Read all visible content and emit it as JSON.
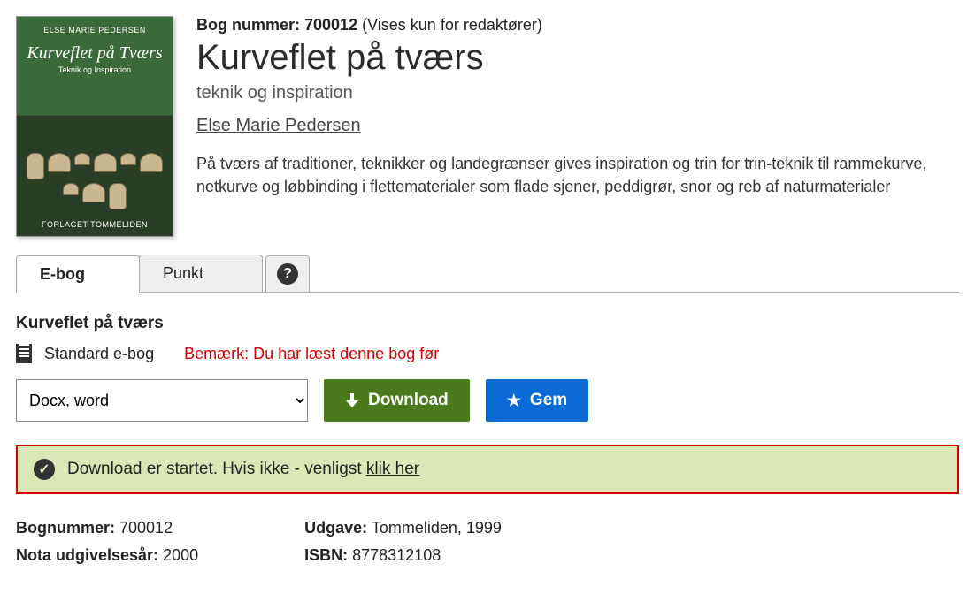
{
  "header": {
    "bognum_label": "Bog nummer:",
    "bognum_value": "700012",
    "bognum_note": "(Vises kun for redaktører)",
    "title": "Kurveflet på tværs",
    "subtitle": "teknik og inspiration",
    "author": "Else Marie Pedersen",
    "description": "På tværs af traditioner, teknikker og landegrænser gives inspiration og trin for trin-teknik til rammekurve, netkurve og løbbinding i flettematerialer som flade sjener, peddigrør, snor og reb af naturmaterialer"
  },
  "cover": {
    "author": "ELSE MARIE PEDERSEN",
    "title": "Kurveflet på Tværs",
    "sub": "Teknik og Inspiration",
    "publisher": "FORLAGET TOMMELIDEN"
  },
  "tabs": {
    "ebog": "E-bog",
    "punkt": "Punkt",
    "help_char": "?"
  },
  "panel": {
    "title": "Kurveflet på tværs",
    "type_label": "Standard e-bog",
    "read_notice": "Bemærk: Du har læst denne bog før",
    "format_selected": "Docx, word",
    "download_label": "Download",
    "save_label": "Gem"
  },
  "alert": {
    "text_before": "Download er startet. Hvis ikke - venligst ",
    "link_text": "klik her",
    "check_char": "✓"
  },
  "meta": {
    "bognummer_label": "Bognummer:",
    "bognummer_value": "700012",
    "udgivelse_label": "Nota udgivelsesår:",
    "udgivelse_value": "2000",
    "udgave_label": "Udgave:",
    "udgave_value": "Tommeliden, 1999",
    "isbn_label": "ISBN:",
    "isbn_value": "8778312108"
  },
  "star_char": "★"
}
